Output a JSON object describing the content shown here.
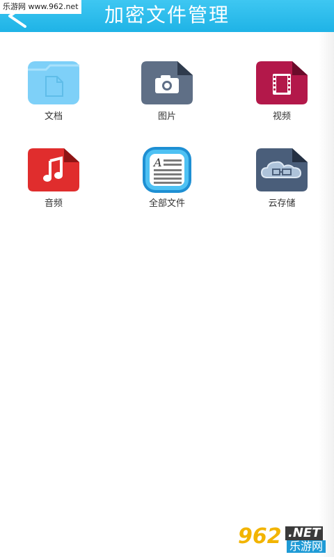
{
  "header": {
    "title": "加密文件管理",
    "watermark_top": "乐游网 www.962.net"
  },
  "tiles": [
    {
      "label": "文档",
      "icon": "folder-document-icon",
      "color": "#7ed0f8"
    },
    {
      "label": "图片",
      "icon": "camera-icon",
      "color": "#5f6f86"
    },
    {
      "label": "视频",
      "icon": "film-icon",
      "color": "#b3184a"
    },
    {
      "label": "音频",
      "icon": "music-note-icon",
      "color": "#e02d2d"
    },
    {
      "label": "全部文件",
      "icon": "all-files-icon",
      "color": "#2aa7e6"
    },
    {
      "label": "云存储",
      "icon": "cloud-storage-icon",
      "color": "#4a5e7a"
    }
  ],
  "watermark_bottom": {
    "number": "962",
    "net": ".NET",
    "cn": "乐游网"
  }
}
